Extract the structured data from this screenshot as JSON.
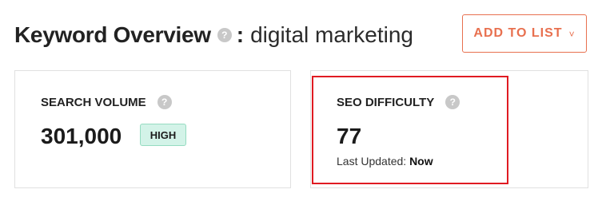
{
  "header": {
    "title": "Keyword Overview",
    "help_icon": "?",
    "separator": ":",
    "keyword": "digital marketing"
  },
  "add_to_list": {
    "label": "ADD TO LIST",
    "chevron": "˅"
  },
  "search_volume": {
    "label": "SEARCH VOLUME",
    "help_icon": "?",
    "value": "301,000",
    "badge": "HIGH"
  },
  "seo_difficulty": {
    "label": "SEO DIFFICULTY",
    "help_icon": "?",
    "value": "77",
    "updated_prefix": "Last Updated: ",
    "updated_value": "Now"
  },
  "colors": {
    "accent": "#e8704f",
    "badge_bg": "#d3f3e8",
    "highlight": "#e01b22"
  }
}
